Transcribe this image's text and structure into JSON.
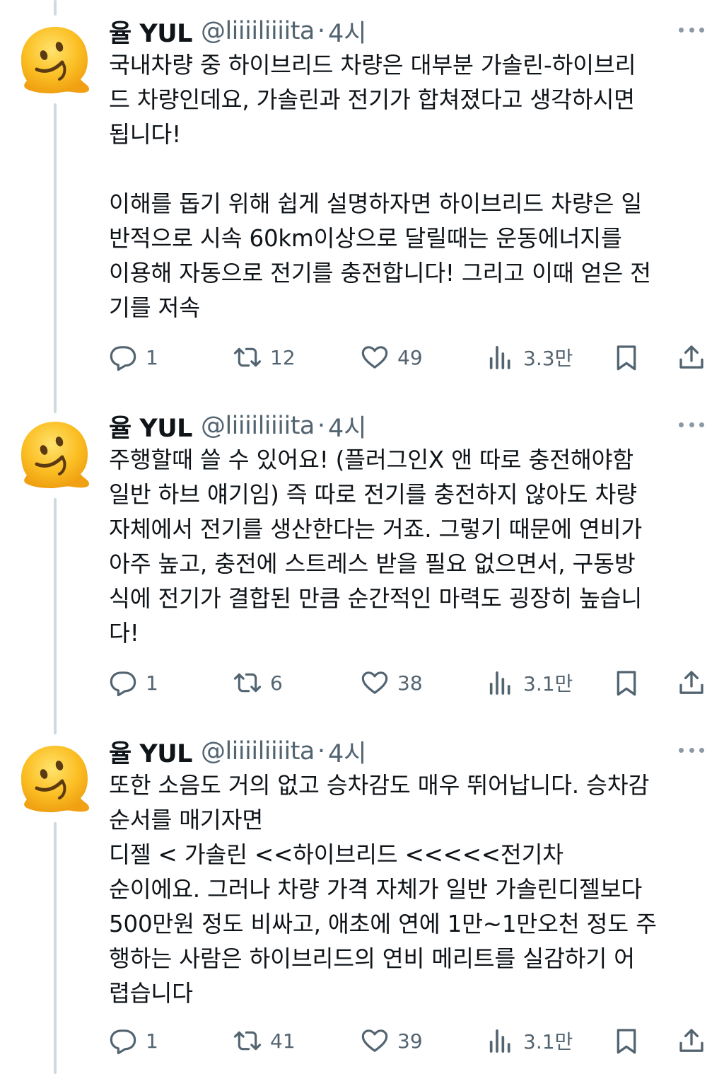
{
  "colors": {
    "text": "#0f1419",
    "secondary": "#536471",
    "thread_line": "#cfd9de",
    "avatar_face": "#f7b21a"
  },
  "icons": {
    "avatar": "melting-face-emoji",
    "more": "more-options-icon",
    "reply": "reply-icon",
    "retweet": "retweet-icon",
    "like": "heart-icon",
    "views": "views-chart-icon",
    "bookmark": "bookmark-icon",
    "share": "share-icon"
  },
  "tweets": [
    {
      "name": "율 YUL",
      "handle": "@liiiiliiiita",
      "dot": "·",
      "time": "4시",
      "text": "국내차량 중 하이브리드 차량은 대부분 가솔린-하이브리\n드 차량인데요, 가솔린과 전기가 합쳐졌다고 생각하시면\n됩니다!\n\n이해를 돕기 위해 쉽게 설명하자면 하이브리드 차량은 일\n반적으로 시속 60km이상으로 달릴때는 운동에너지를\n이용해 자동으로 전기를 충전합니다! 그리고 이때 얻은 전\n기를 저속",
      "replies": "1",
      "retweets": "12",
      "likes": "49",
      "views": "3.3만"
    },
    {
      "name": "율 YUL",
      "handle": "@liiiiliiiita",
      "dot": "·",
      "time": "4시",
      "text": "주행할때 쓸 수 있어요! (플러그인X 앤 따로 충전해야함\n일반 하브 얘기임) 즉 따로 전기를 충전하지 않아도 차량\n자체에서 전기를 생산한다는 거죠. 그렇기 때문에 연비가\n아주 높고, 충전에 스트레스 받을 필요 없으면서, 구동방\n식에 전기가 결합된 만큼 순간적인 마력도 굉장히 높습니\n다!",
      "replies": "1",
      "retweets": "6",
      "likes": "38",
      "views": "3.1만"
    },
    {
      "name": "율 YUL",
      "handle": "@liiiiliiiita",
      "dot": "·",
      "time": "4시",
      "text": "또한 소음도 거의 없고 승차감도 매우 뛰어납니다. 승차감\n순서를 매기자면\n디젤 < 가솔린 <<하이브리드 <<<<<전기차\n순이에요. 그러나 차량 가격 자체가 일반 가솔린디젤보다\n500만원 정도 비싸고, 애초에 연에 1만~1만오천 정도 주\n행하는 사람은 하이브리드의 연비 메리트를 실감하기 어\n렵습니다",
      "replies": "1",
      "retweets": "41",
      "likes": "39",
      "views": "3.1만"
    }
  ]
}
